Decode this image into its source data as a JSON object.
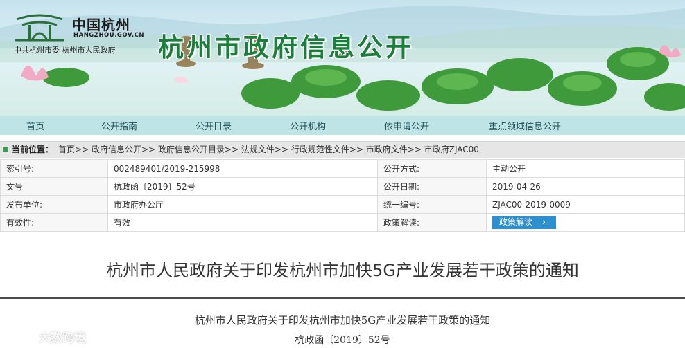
{
  "banner": {
    "site_name": "中国杭州",
    "site_domain": "HANGZHOU.GOV.CN",
    "site_orgs": "中共杭州市委   杭州市人民政府",
    "title": "杭州市政府信息公开"
  },
  "nav": {
    "items": [
      "首页",
      "公开指南",
      "公开目录",
      "公开机构",
      "依申请公开",
      "重点领域信息公开"
    ]
  },
  "breadcrumb": {
    "label": "当前位置：",
    "items": [
      "首页",
      "政府信息公开",
      "政府信息公开目录",
      "法规文件",
      "行政规范性文件",
      "市政府文件",
      "市政府ZJAC00"
    ],
    "separator": ">>"
  },
  "info": {
    "rows": [
      {
        "k1": "索引号:",
        "v1": "002489401/2019-215998",
        "k2": "公开方式:",
        "v2": "主动公开"
      },
      {
        "k1": "文号",
        "v1": "杭政函〔2019〕52号",
        "k2": "公开日期:",
        "v2": "2019-04-26"
      },
      {
        "k1": "发布单位:",
        "v1": "市政府办公厅",
        "k2": "统一编号:",
        "v2": "ZJAC00-2019-0009"
      },
      {
        "k1": "有效性:",
        "v1": "有效",
        "k2": "政策解读:",
        "v2": ""
      }
    ],
    "interpretation_button": "政策解读",
    "interpretation_chevron": "›"
  },
  "document": {
    "title": "杭州市人民政府关于印发杭州市加快5G产业发展若干政策的通知",
    "subtitle": "杭州市人民政府关于印发杭州市加快5G产业发展若干政策的通知",
    "number": "杭政函〔2019〕52号"
  },
  "watermark": {
    "text": "大数跨境"
  },
  "colors": {
    "nav_bg": "#bfe4e6",
    "banner_title": "#1a7f3a",
    "button_blue": "#2c8fd0"
  }
}
